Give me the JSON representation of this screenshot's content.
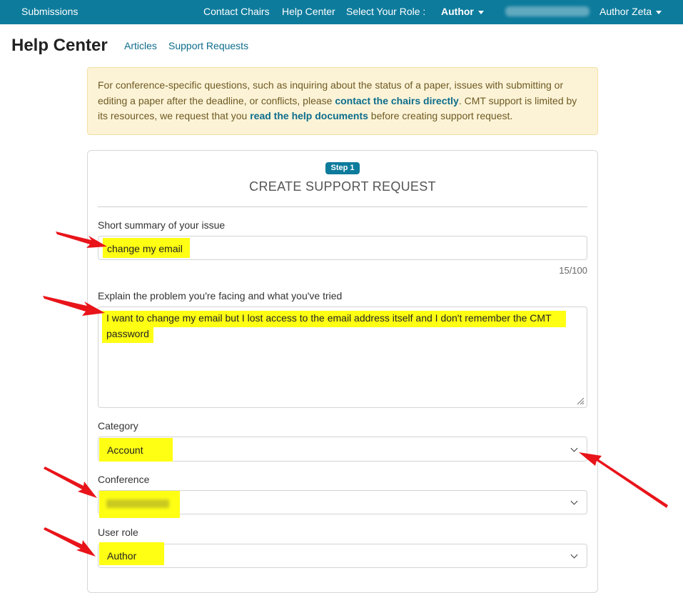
{
  "nav": {
    "submissions": "Submissions",
    "contact_chairs": "Contact Chairs",
    "help_center": "Help Center",
    "select_role_label": "Select Your Role :",
    "role": "Author",
    "user": "Author Zeta"
  },
  "header": {
    "title": "Help Center",
    "links": [
      "Articles",
      "Support Requests"
    ]
  },
  "alert": {
    "text_1": "For conference-specific questions, such as inquiring about the status of a paper, issues with submitting or editing a paper after the deadline, or conflicts, please ",
    "link_1": "contact the chairs directly",
    "text_2": ". CMT support is limited by its resources, we request that you ",
    "link_2": "read the help documents",
    "text_3": " before creating support request."
  },
  "form": {
    "step_badge": "Step 1",
    "title": "CREATE SUPPORT REQUEST",
    "summary_label": "Short summary of your issue",
    "summary_value": "change my email",
    "summary_counter": "15/100",
    "problem_label": "Explain the problem you're facing and what you've tried",
    "problem_line_1": "I want to change my email but I lost access to the email address itself and I don't remember the CMT",
    "problem_line_2": "password",
    "category_label": "Category",
    "category_value": "Account",
    "conference_label": "Conference",
    "user_role_label": "User role",
    "user_role_value": "Author"
  },
  "colors": {
    "nav_bg": "#0d7b9c",
    "link": "#0d6d8c",
    "highlight": "#ffff14",
    "annotation_arrow": "#e8141a"
  }
}
